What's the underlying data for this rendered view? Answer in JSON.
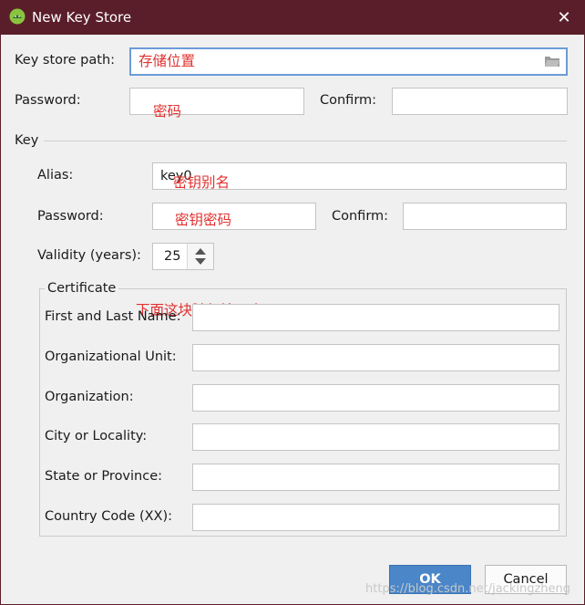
{
  "window": {
    "title": "New Key Store",
    "close_glyph": "✕"
  },
  "keystore": {
    "path_label": "Key store path:",
    "path_value": "存储位置",
    "password_label": "Password:",
    "password_value": "密码",
    "confirm_label": "Confirm:",
    "confirm_value": ""
  },
  "key": {
    "section_label": "Key",
    "alias_label": "Alias:",
    "alias_value": "key0",
    "alias_annotation": "密钥别名",
    "password_label": "Password:",
    "password_value": "密钥密码",
    "confirm_label": "Confirm:",
    "confirm_value": "",
    "validity_label": "Validity (years):",
    "validity_value": "25"
  },
  "certificate": {
    "section_label": "Certificate",
    "annotation": "下面这块随便填一个",
    "fields": [
      {
        "label": "First and Last Name:",
        "value": ""
      },
      {
        "label": "Organizational Unit:",
        "value": ""
      },
      {
        "label": "Organization:",
        "value": ""
      },
      {
        "label": "City or Locality:",
        "value": ""
      },
      {
        "label": "State or Province:",
        "value": ""
      },
      {
        "label": "Country Code (XX):",
        "value": ""
      }
    ]
  },
  "buttons": {
    "ok": "OK",
    "cancel": "Cancel"
  },
  "watermark": "https://blog.csdn.net/jackingzheng",
  "colors": {
    "titlebar": "#5a1e2a",
    "ok_button": "#4a86c8",
    "annotation": "#e0312f"
  }
}
